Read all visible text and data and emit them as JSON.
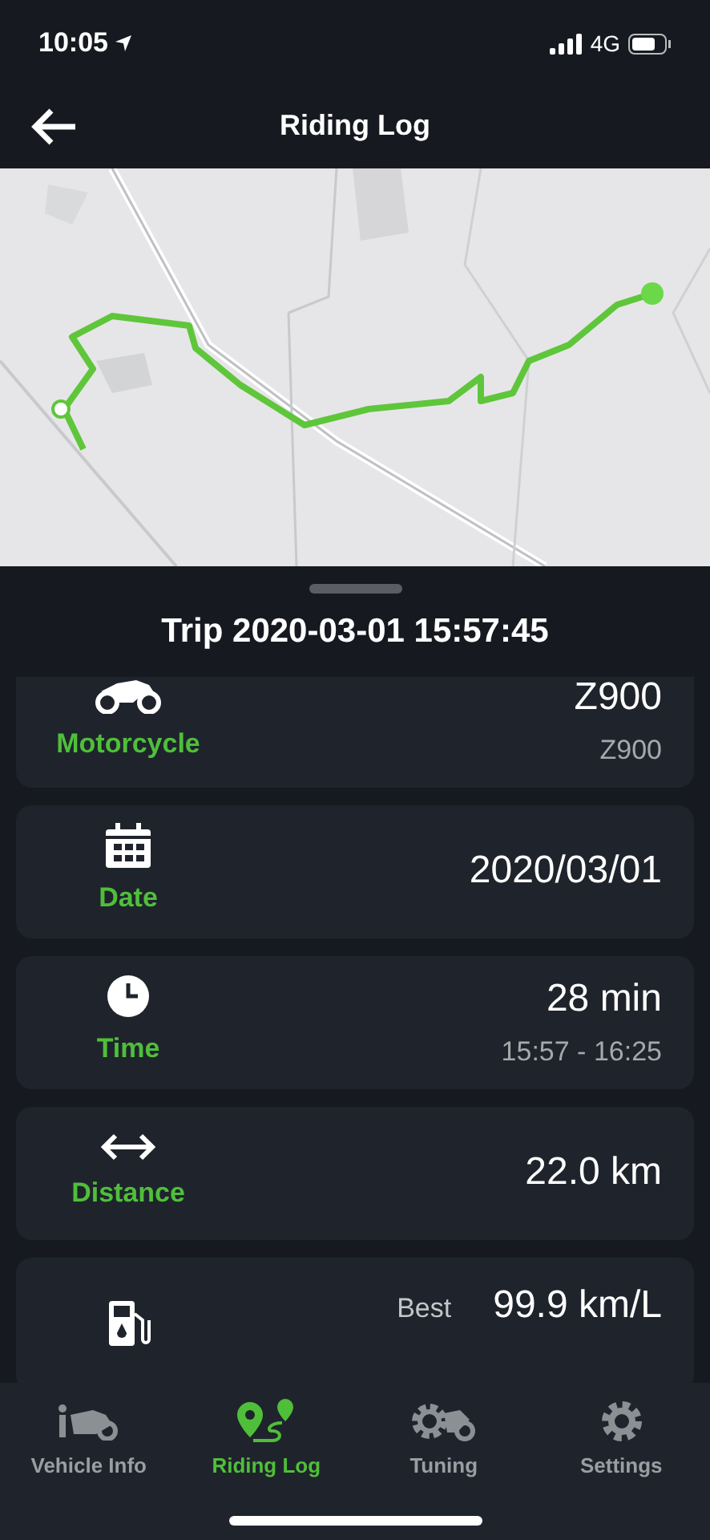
{
  "status_bar": {
    "time": "10:05",
    "network": "4G"
  },
  "header": {
    "title": "Riding Log"
  },
  "trip": {
    "title": "Trip 2020-03-01 15:57:45"
  },
  "cards": [
    {
      "kind": "motorcycle",
      "label": "Motorcycle",
      "value": "Z900",
      "sub_value": "Z900"
    },
    {
      "kind": "date",
      "label": "Date",
      "value": "2020/03/01"
    },
    {
      "kind": "time",
      "label": "Time",
      "value": "28 min",
      "sub_value": "15:57 - 16:25"
    },
    {
      "kind": "distance",
      "label": "Distance",
      "value": "22.0 km"
    },
    {
      "kind": "fuel",
      "prefix": "Best",
      "value": "99.9 km/L"
    }
  ],
  "tabs": [
    {
      "kind": "vehicle",
      "label": "Vehicle Info",
      "selected": false
    },
    {
      "kind": "log",
      "label": "Riding Log",
      "selected": true
    },
    {
      "kind": "tuning",
      "label": "Tuning",
      "selected": false
    },
    {
      "kind": "settings",
      "label": "Settings",
      "selected": false
    }
  ]
}
